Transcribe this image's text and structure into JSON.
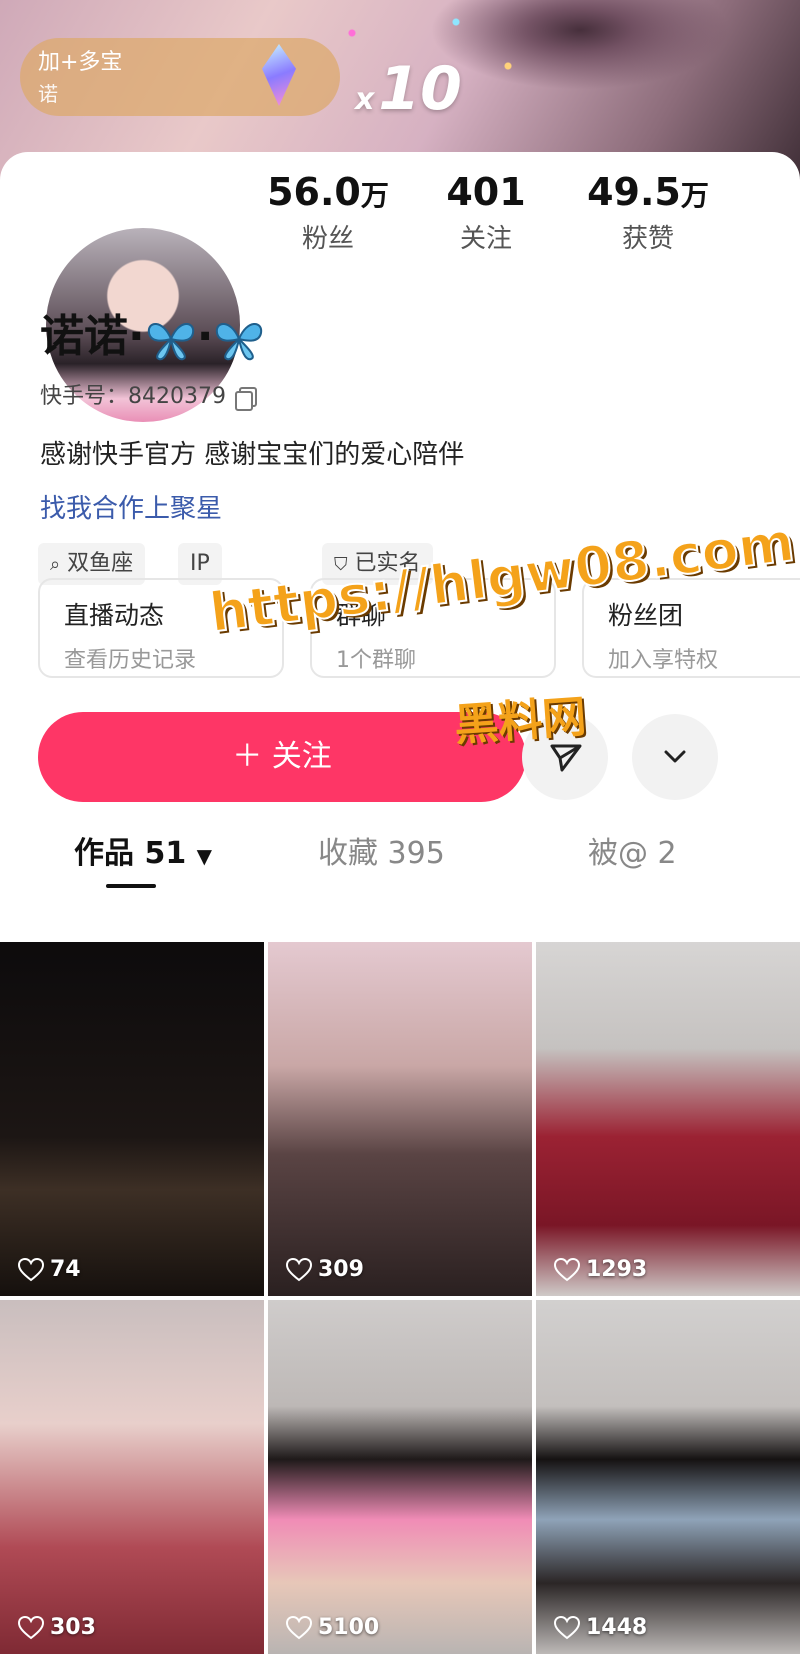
{
  "promo": {
    "title": "加+多宝",
    "subtitle": "诺",
    "multiplier_prefix": "x",
    "multiplier_value": "10"
  },
  "stats": [
    {
      "value": "56.0",
      "unit": "万",
      "label": "粉丝"
    },
    {
      "value": "401",
      "unit": "",
      "label": "关注"
    },
    {
      "value": "49.5",
      "unit": "万",
      "label": "获赞"
    }
  ],
  "profile": {
    "name": "诺诺·",
    "name_mid": "·",
    "kuaishou_id_label": "快手号：",
    "kuaishou_id": "8420379",
    "bio": "感谢快手官方 感谢宝宝们的爱心陪伴",
    "collab_link": "找我合作上聚星",
    "tags": [
      "双鱼座",
      "IP",
      "已实名"
    ]
  },
  "watermark": {
    "url": "https://hlgw08.com",
    "site": "黑料网"
  },
  "quick_cards": [
    {
      "title": "直播动态",
      "subtitle": "查看历史记录"
    },
    {
      "title": "群聊",
      "subtitle": "1个群聊"
    },
    {
      "title": "粉丝团",
      "subtitle": "加入享特权"
    }
  ],
  "actions": {
    "follow_label": "＋ 关注"
  },
  "tabs": [
    {
      "label": "作品 51"
    },
    {
      "label": "收藏 395"
    },
    {
      "label": "被@ 2"
    }
  ],
  "posts": [
    {
      "likes": "74"
    },
    {
      "likes": "309"
    },
    {
      "likes": "1293"
    },
    {
      "likes": "303"
    },
    {
      "likes": "5100"
    },
    {
      "likes": "1448"
    }
  ],
  "colors": {
    "follow": "#fe3666",
    "link": "#3b5bab",
    "watermark": "#f4a21a"
  }
}
